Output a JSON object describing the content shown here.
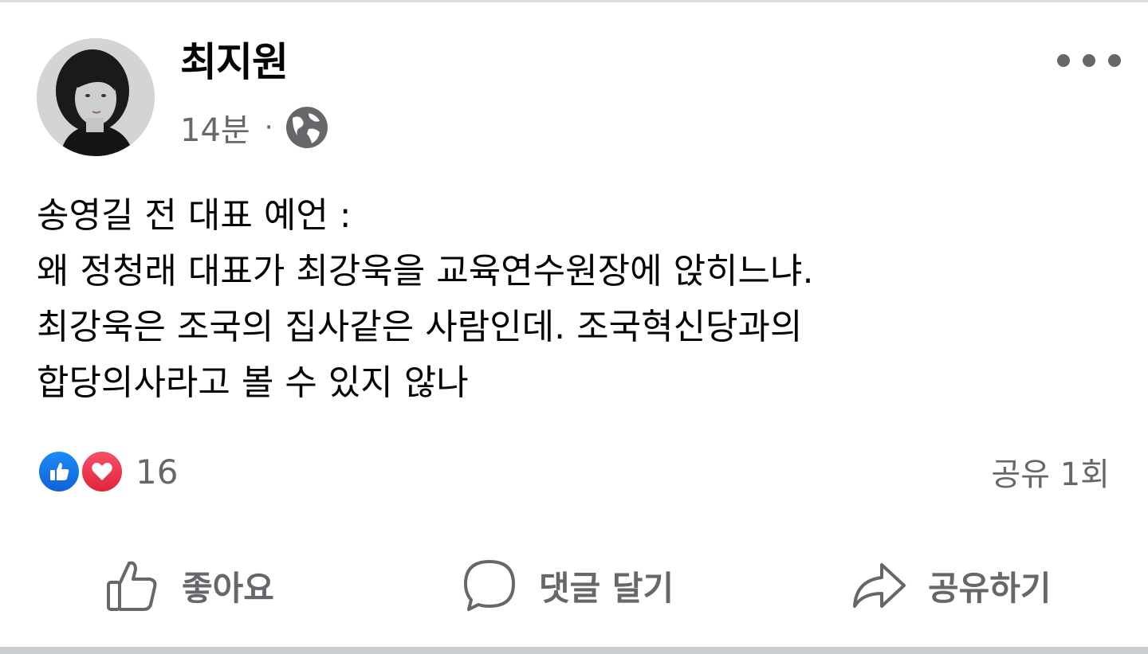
{
  "author": {
    "name": "최지원",
    "avatar_alt": "profile-photo"
  },
  "meta": {
    "time": "14분",
    "separator": "·",
    "audience_icon": "globe-icon"
  },
  "more_icon": "more-dots-icon",
  "message": {
    "lines": [
      "송영길 전 대표 예언 :",
      "왜 정청래 대표가 최강욱을 교육연수원장에 앉히느냐.",
      "최강욱은 조국의 집사같은 사람인데. 조국혁신당과의",
      "합당의사라고 볼 수 있지 않나"
    ]
  },
  "reactions": {
    "icons": [
      "like-reaction-icon",
      "love-reaction-icon"
    ],
    "count": "16"
  },
  "shares": {
    "label": "공유 1회"
  },
  "actions": {
    "like_label": "좋아요",
    "comment_label": "댓글 달기",
    "share_label": "공유하기"
  },
  "colors": {
    "text": "#050505",
    "secondary": "#65676b",
    "like_blue": "#1877f2",
    "love_red": "#f33e58"
  }
}
